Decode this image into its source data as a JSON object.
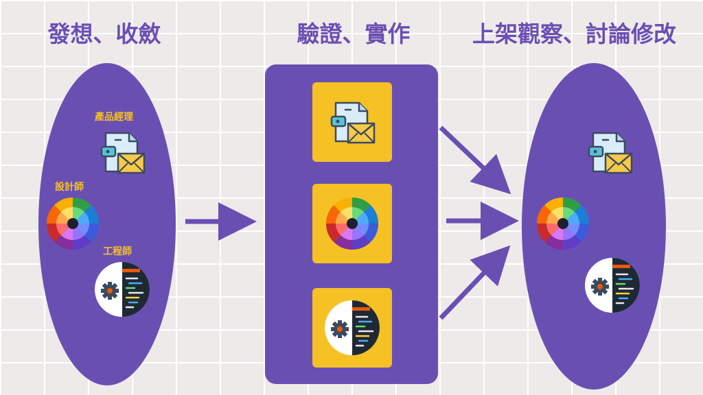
{
  "headings": {
    "phase_1": "發想、收斂",
    "phase_2": "驗證、實作",
    "phase_3": "上架觀察、討論修改"
  },
  "roles": {
    "product_manager": "產品經理",
    "designer": "設計師",
    "engineer": "工程師"
  },
  "colors": {
    "background": "#eeeaea",
    "grid": "#ffffff",
    "purple": "#6a4fb3",
    "yellow": "#f5c124"
  },
  "icons": [
    "document-mail-icon",
    "color-wheel-icon",
    "code-gear-icon"
  ]
}
